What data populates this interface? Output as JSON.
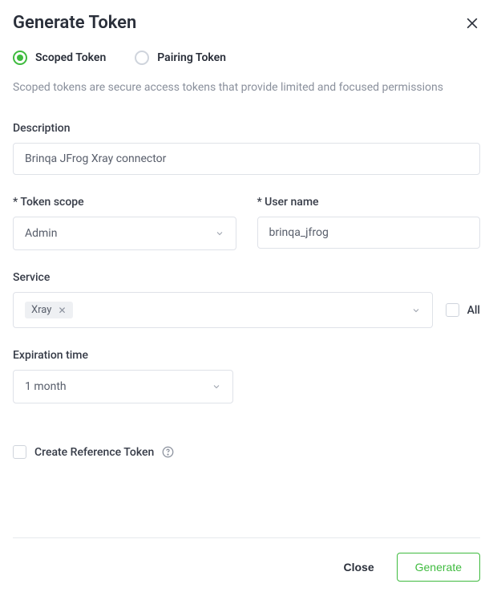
{
  "title": "Generate Token",
  "radioOptions": {
    "scoped": "Scoped Token",
    "pairing": "Pairing Token"
  },
  "helpText": "Scoped tokens are secure access tokens that provide limited and focused permissions",
  "fields": {
    "description": {
      "label": "Description",
      "value": "Brinqa JFrog Xray connector"
    },
    "tokenScope": {
      "label": "* Token scope",
      "value": "Admin"
    },
    "userName": {
      "label": "* User name",
      "value": "brinqa_jfrog"
    },
    "service": {
      "label": "Service",
      "tag": "Xray",
      "allLabel": "All"
    },
    "expiration": {
      "label": "Expiration time",
      "value": "1 month"
    },
    "refToken": {
      "label": "Create Reference Token"
    }
  },
  "buttons": {
    "close": "Close",
    "generate": "Generate"
  }
}
